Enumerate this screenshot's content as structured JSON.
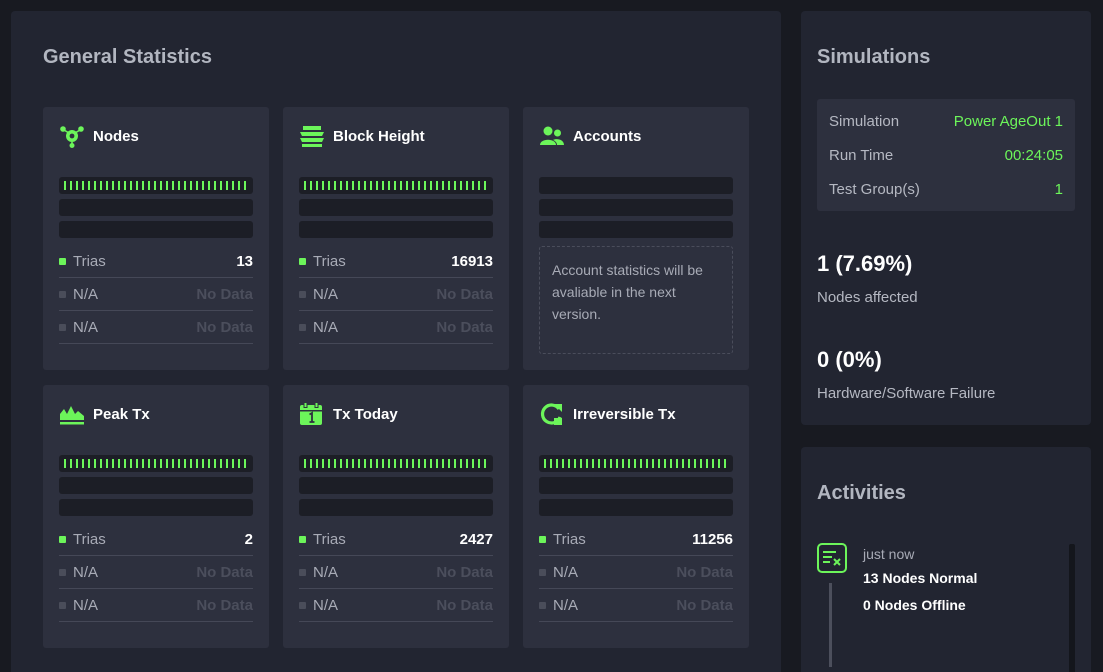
{
  "general": {
    "title": "General Statistics",
    "cards": [
      {
        "title": "Nodes",
        "icon": "nodes-icon",
        "rows": [
          {
            "label": "Trias",
            "value": "13",
            "active": true
          },
          {
            "label": "N/A",
            "value": "No Data",
            "active": false
          },
          {
            "label": "N/A",
            "value": "No Data",
            "active": false
          }
        ]
      },
      {
        "title": "Block Height",
        "icon": "layers-icon",
        "rows": [
          {
            "label": "Trias",
            "value": "16913",
            "active": true
          },
          {
            "label": "N/A",
            "value": "No Data",
            "active": false
          },
          {
            "label": "N/A",
            "value": "No Data",
            "active": false
          }
        ]
      },
      {
        "title": "Accounts",
        "icon": "users-icon",
        "note": "Account statistics will be avaliable in the next version."
      },
      {
        "title": "Peak Tx",
        "icon": "peak-chart-icon",
        "rows": [
          {
            "label": "Trias",
            "value": "2",
            "active": true
          },
          {
            "label": "N/A",
            "value": "No Data",
            "active": false
          },
          {
            "label": "N/A",
            "value": "No Data",
            "active": false
          }
        ]
      },
      {
        "title": "Tx Today",
        "icon": "calendar-icon",
        "rows": [
          {
            "label": "Trias",
            "value": "2427",
            "active": true
          },
          {
            "label": "N/A",
            "value": "No Data",
            "active": false
          },
          {
            "label": "N/A",
            "value": "No Data",
            "active": false
          }
        ]
      },
      {
        "title": "Irreversible Tx",
        "icon": "refresh-icon",
        "rows": [
          {
            "label": "Trias",
            "value": "11256",
            "active": true
          },
          {
            "label": "N/A",
            "value": "No Data",
            "active": false
          },
          {
            "label": "N/A",
            "value": "No Data",
            "active": false
          }
        ]
      }
    ]
  },
  "simulations": {
    "title": "Simulations",
    "details": [
      {
        "key": "Simulation",
        "value": "Power AgeOut 1"
      },
      {
        "key": "Run Time",
        "value": "00:24:05"
      },
      {
        "key": "Test Group(s)",
        "value": "1"
      }
    ],
    "nodes_affected": {
      "value": "1 (7.69%)",
      "label": "Nodes affected"
    },
    "failure": {
      "value": "0 (0%)",
      "label": "Hardware/Software Failure"
    }
  },
  "activities": {
    "title": "Activities",
    "items": [
      {
        "time": "just now",
        "icon": "activity-log-icon",
        "lines": [
          "13 Nodes Normal",
          "0 Nodes Offline"
        ]
      }
    ]
  },
  "colors": {
    "accent": "#6cf55a",
    "panel": "#222531",
    "card": "#2d303e",
    "background": "#181a21"
  }
}
